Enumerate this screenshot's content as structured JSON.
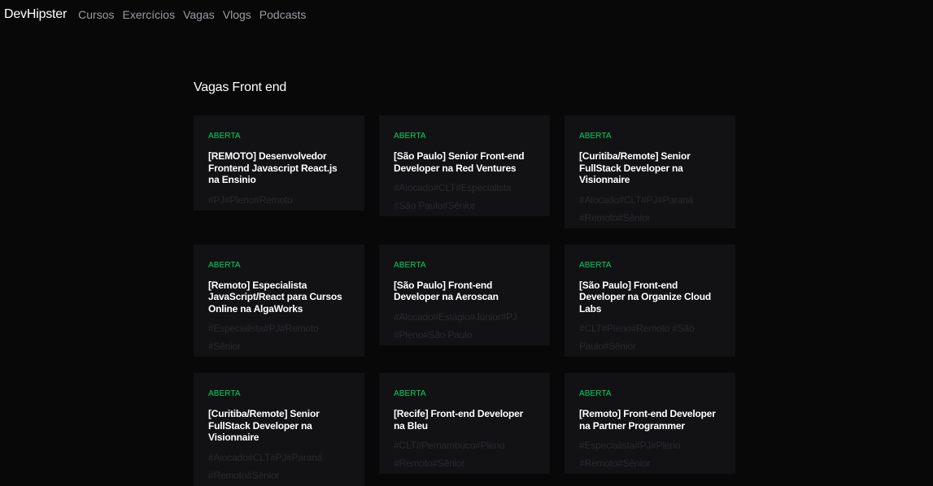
{
  "nav": {
    "brand": "DevHipster",
    "links": [
      "Cursos",
      "Exercícios",
      "Vagas",
      "Vlogs",
      "Podcasts"
    ]
  },
  "page": {
    "title": "Vagas Front end"
  },
  "jobs": [
    {
      "status": "ABERTA",
      "title": "[REMOTO] Desenvolvedor Frontend Javascript React.js na Ensinio",
      "tags": "#PJ#Pleno#Remoto"
    },
    {
      "status": "ABERTA",
      "title": "[São Paulo] Senior Front-end Developer na Red Ventures",
      "tags": "#Alocado#CLT#Especialista #São Paulo#Sênior"
    },
    {
      "status": "ABERTA",
      "title": "[Curitiba/Remote] Senior FullStack Developer na Visionnaire",
      "tags": "#Alocado#CLT#PJ#Paraná #Remoto#Sênior"
    },
    {
      "status": "ABERTA",
      "title": "[Remoto] Especialista JavaScript/React para Cursos Online na AlgaWorks",
      "tags": "#Especialista#PJ#Remoto #Sênior"
    },
    {
      "status": "ABERTA",
      "title": "[São Paulo] Front-end Developer na Aeroscan",
      "tags": "#Alocado#Estágio#Júnior#PJ #Pleno#São Paulo"
    },
    {
      "status": "ABERTA",
      "title": "[São Paulo] Front-end Developer na Organize Cloud Labs",
      "tags": "#CLT#Pleno#Remoto #São Paulo#Sênior"
    },
    {
      "status": "ABERTA",
      "title": "[Curitiba/Remote] Senior FullStack Developer na Visionnaire",
      "tags": "#Alocado#CLT#PJ#Paraná #Remoto#Sênior"
    },
    {
      "status": "ABERTA",
      "title": "[Recife] Front-end Developer na Bleu",
      "tags": "#CLT#Pernambuco#Pleno #Remoto#Sênior"
    },
    {
      "status": "ABERTA",
      "title": "[Remoto] Front-end Developer na Partner Programmer",
      "tags": "#Especialista#PJ#Pleno #Remoto#Sênior"
    }
  ],
  "colors": {
    "background": "#080809",
    "card": "#121214",
    "status": "#04d361",
    "tags": "#29292e",
    "nav_link": "#9b9ba3"
  }
}
